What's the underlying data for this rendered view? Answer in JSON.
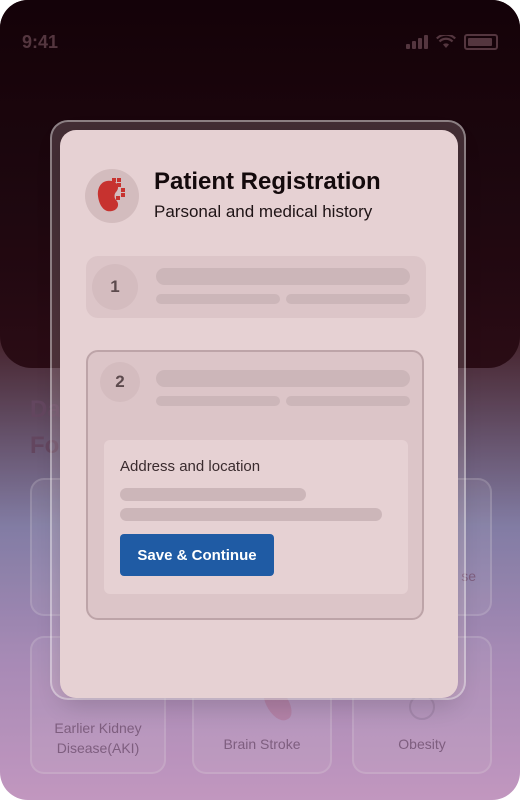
{
  "status_bar": {
    "time": "9:41"
  },
  "background": {
    "heading_line1": "Da",
    "heading_line2": "Fo",
    "cards": [
      {
        "label": ""
      },
      {
        "label": "se"
      },
      {
        "label": "Earlier Kidney\nDisease(AKI)"
      },
      {
        "label": "Brain Stroke"
      },
      {
        "label": "Obesity"
      }
    ]
  },
  "modal": {
    "title": "Patient Registration",
    "subtitle": "Parsonal and medical history",
    "logo_icon": "kidney-icon",
    "steps": [
      {
        "number": "1"
      },
      {
        "number": "2",
        "section_label": "Address and location",
        "button_label": "Save & Continue"
      }
    ]
  },
  "colors": {
    "accent": "#1f5ba4",
    "modal_bg": "#e6d1d3",
    "kidney": "#c7322f"
  }
}
